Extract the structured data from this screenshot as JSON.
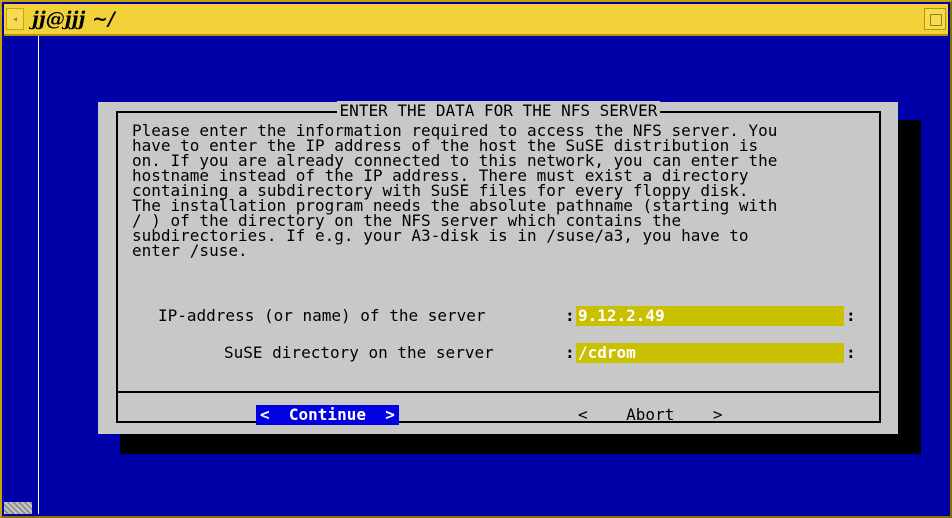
{
  "window": {
    "title": "jj@jjj ~/"
  },
  "dialog": {
    "title": "ENTER THE DATA FOR THE NFS SERVER",
    "info_lines": [
      "Please enter the information required to access the NFS server. You",
      "have to enter the IP address of the host the SuSE distribution is",
      "on. If you are already connected to this network, you can enter the",
      "hostname instead of the IP address. There must exist a directory",
      "containing a subdirectory with SuSE files for every floppy disk.",
      "The installation program needs the absolute pathname (starting with",
      "/ ) of the directory on the NFS server which contains the",
      "subdirectories. If e.g. your A3-disk is in /suse/a3, you have to",
      "enter /suse."
    ],
    "fields": [
      {
        "label": "IP-address (or name) of the server",
        "value": "9.12.2.49"
      },
      {
        "label": "SuSE directory on the server",
        "value": "/cdrom"
      }
    ],
    "buttons": {
      "continue": "<  Continue  >",
      "abort": "<    Abort    >"
    }
  },
  "colors": {
    "terminal_bg": "#0000a8",
    "dialog_bg": "#c8c8c8",
    "field_bg": "#c8c000",
    "titlebar": "#f2d23a",
    "active_button": "#0000e0"
  }
}
